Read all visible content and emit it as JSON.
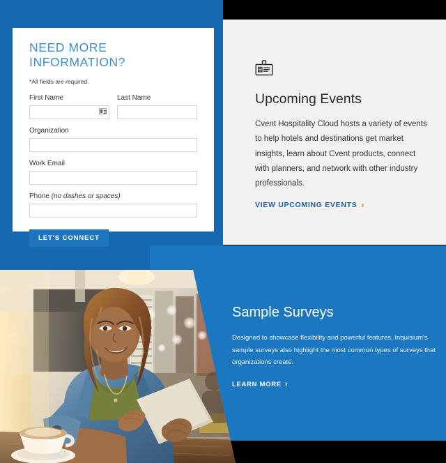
{
  "theme": {
    "blue_dark": "#1568b0",
    "blue_light": "#1b78c0",
    "panel_gray": "#f2f2f2",
    "accent_orange": "#ef7622",
    "link_blue": "#1b5ea0",
    "title_blue": "#3f8ccb",
    "button_blue": "#1d76bd",
    "black": "#000000"
  },
  "form": {
    "title": "NEED MORE INFORMATION?",
    "required_note": "*All fields are required.",
    "fields": [
      {
        "label": "First Name",
        "value": "",
        "placeholder": "",
        "icon": "autofill-contact-card-icon"
      },
      {
        "label": "Last Name",
        "value": "",
        "placeholder": ""
      },
      {
        "label": "Organization",
        "value": "",
        "placeholder": ""
      },
      {
        "label": "Work Email",
        "value": "",
        "placeholder": ""
      },
      {
        "label": "Phone",
        "hint": "(no dashes or spaces)",
        "value": "",
        "placeholder": ""
      }
    ],
    "submit_label": "LET'S CONNECT"
  },
  "events": {
    "icon": "id-badge-icon",
    "title": "Upcoming Events",
    "body": "Cvent Hospitality Cloud hosts a variety of events to help hotels and destinations get market insights, learn about Cvent products, connect with planners, and network with other industry professionals.",
    "link_label": "VIEW UPCOMING EVENTS",
    "link_chevron": "›"
  },
  "surveys": {
    "title": "Sample Surveys",
    "body": "Designed to showcase flexibility and powerful features, Inquisium's sample surveys also highlight the most common types of surveys that organizations create.",
    "link_label": "LEARN MORE",
    "link_chevron": "›"
  },
  "photo": {
    "alt": "Woman in denim jacket using a tablet at a cafe table with a coffee cup"
  }
}
